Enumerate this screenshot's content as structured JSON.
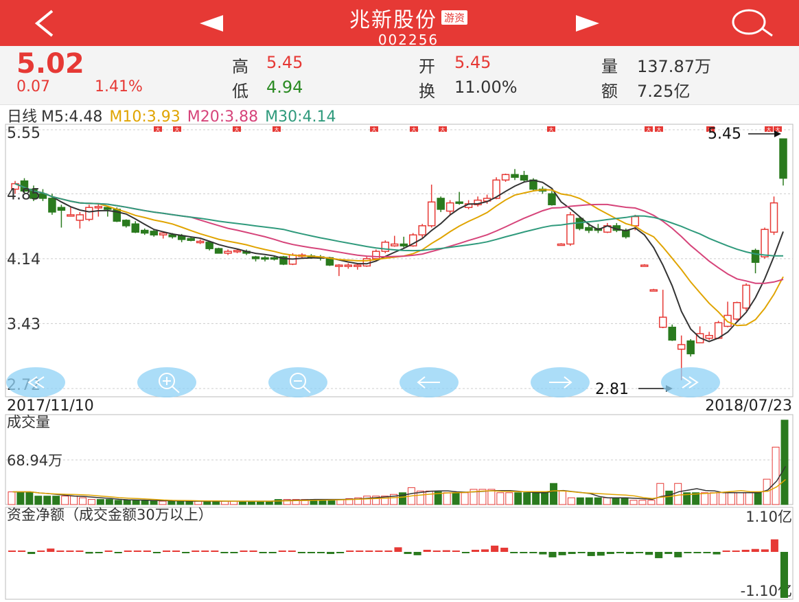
{
  "header": {
    "stock_name": "兆新股份",
    "tag": "游资",
    "stock_code": "002256",
    "back_icon": "back-icon",
    "prev_icon": "prev-stock-icon",
    "next_icon": "next-stock-icon",
    "search_icon": "search-icon"
  },
  "quote": {
    "price": "5.02",
    "change": "0.07",
    "change_pct": "1.41%",
    "high_label": "高",
    "high": "5.45",
    "low_label": "低",
    "low": "4.94",
    "open_label": "开",
    "open": "5.45",
    "turnover_label": "换",
    "turnover": "11.00%",
    "volume_label": "量",
    "volume": "137.87万",
    "amount_label": "额",
    "amount": "7.25亿"
  },
  "ma": {
    "period": "日线",
    "m5": "M5:4.48",
    "m10": "M10:3.93",
    "m20": "M20:3.88",
    "m30": "M30:4.14"
  },
  "colors": {
    "red": "#e63935",
    "green": "#2a7a1e",
    "m5": "#333333",
    "m10": "#e0a400",
    "m20": "#d6447a",
    "m30": "#2f9a7c"
  },
  "toolbar": [
    "rewind-icon",
    "zoom-in-icon",
    "zoom-out-icon",
    "left-arrow-icon",
    "right-arrow-icon",
    "fast-forward-icon"
  ],
  "chart_data": [
    {
      "type": "candlestick",
      "title": "日线",
      "y_ticks": [
        "5.55",
        "4.85",
        "4.14",
        "3.43",
        "2.72"
      ],
      "ylim": [
        2.72,
        5.55
      ],
      "x_start": "2017/11/10",
      "x_end": "2018/07/23",
      "max_annotation": "5.45",
      "min_annotation": "2.81",
      "marker_label": "大",
      "candles": [
        {
          "o": 4.9,
          "c": 4.96,
          "h": 4.99,
          "l": 4.85
        },
        {
          "o": 4.99,
          "c": 4.88,
          "h": 5.02,
          "l": 4.86
        },
        {
          "o": 4.9,
          "c": 4.8,
          "h": 4.94,
          "l": 4.77
        },
        {
          "o": 4.85,
          "c": 4.8,
          "h": 4.9,
          "l": 4.77
        },
        {
          "o": 4.8,
          "c": 4.65,
          "h": 4.85,
          "l": 4.62
        },
        {
          "o": 4.7,
          "c": 4.67,
          "h": 4.73,
          "l": 4.48
        },
        {
          "o": 4.62,
          "c": 4.62,
          "h": 4.7,
          "l": 4.6
        },
        {
          "o": 4.56,
          "c": 4.62,
          "h": 4.65,
          "l": 4.47
        },
        {
          "o": 4.57,
          "c": 4.7,
          "h": 4.73,
          "l": 4.55
        },
        {
          "o": 4.7,
          "c": 4.71,
          "h": 4.74,
          "l": 4.6
        },
        {
          "o": 4.7,
          "c": 4.68,
          "h": 4.72,
          "l": 4.6
        },
        {
          "o": 4.68,
          "c": 4.55,
          "h": 4.7,
          "l": 4.54
        },
        {
          "o": 4.56,
          "c": 4.5,
          "h": 4.57,
          "l": 4.48
        },
        {
          "o": 4.52,
          "c": 4.43,
          "h": 4.55,
          "l": 4.42
        },
        {
          "o": 4.45,
          "c": 4.42,
          "h": 4.47,
          "l": 4.4
        },
        {
          "o": 4.44,
          "c": 4.4,
          "h": 4.46,
          "l": 4.38
        },
        {
          "o": 4.4,
          "c": 4.42,
          "h": 4.44,
          "l": 4.36
        },
        {
          "o": 4.4,
          "c": 4.38,
          "h": 4.42,
          "l": 4.36
        },
        {
          "o": 4.39,
          "c": 4.35,
          "h": 4.41,
          "l": 4.32
        },
        {
          "o": 4.36,
          "c": 4.34,
          "h": 4.38,
          "l": 4.33
        },
        {
          "o": 4.33,
          "c": 4.33,
          "h": 4.35,
          "l": 4.3
        },
        {
          "o": 4.32,
          "c": 4.25,
          "h": 4.33,
          "l": 4.23
        },
        {
          "o": 4.25,
          "c": 4.2,
          "h": 4.26,
          "l": 4.2
        },
        {
          "o": 4.2,
          "c": 4.22,
          "h": 4.24,
          "l": 4.18
        },
        {
          "o": 4.22,
          "c": 4.23,
          "h": 4.25,
          "l": 4.2
        },
        {
          "o": 4.22,
          "c": 4.2,
          "h": 4.24,
          "l": 4.18
        },
        {
          "o": 4.16,
          "c": 4.14,
          "h": 4.17,
          "l": 4.11
        },
        {
          "o": 4.15,
          "c": 4.14,
          "h": 4.17,
          "l": 4.11
        },
        {
          "o": 4.15,
          "c": 4.14,
          "h": 4.17,
          "l": 4.12
        },
        {
          "o": 4.16,
          "c": 4.08,
          "h": 4.17,
          "l": 4.07
        },
        {
          "o": 4.08,
          "c": 4.18,
          "h": 4.2,
          "l": 4.07
        },
        {
          "o": 4.17,
          "c": 4.18,
          "h": 4.2,
          "l": 4.14
        },
        {
          "o": 4.17,
          "c": 4.16,
          "h": 4.19,
          "l": 4.14
        },
        {
          "o": 4.16,
          "c": 4.15,
          "h": 4.18,
          "l": 4.12
        },
        {
          "o": 4.15,
          "c": 4.07,
          "h": 4.16,
          "l": 4.06
        },
        {
          "o": 4.07,
          "c": 4.07,
          "h": 4.08,
          "l": 3.95
        },
        {
          "o": 4.07,
          "c": 4.07,
          "h": 4.09,
          "l": 4.03
        },
        {
          "o": 4.06,
          "c": 4.07,
          "h": 4.08,
          "l": 4.02
        },
        {
          "o": 4.06,
          "c": 4.14,
          "h": 4.16,
          "l": 4.05
        },
        {
          "o": 4.14,
          "c": 4.22,
          "h": 4.24,
          "l": 4.12
        },
        {
          "o": 4.22,
          "c": 4.32,
          "h": 4.34,
          "l": 4.2
        },
        {
          "o": 4.28,
          "c": 4.3,
          "h": 4.39,
          "l": 4.27
        },
        {
          "o": 4.3,
          "c": 4.28,
          "h": 4.38,
          "l": 4.26
        },
        {
          "o": 4.28,
          "c": 4.4,
          "h": 4.42,
          "l": 4.27
        },
        {
          "o": 4.4,
          "c": 4.5,
          "h": 4.52,
          "l": 4.37
        },
        {
          "o": 4.5,
          "c": 4.76,
          "h": 4.95,
          "l": 4.48
        },
        {
          "o": 4.8,
          "c": 4.68,
          "h": 4.82,
          "l": 4.65
        },
        {
          "o": 4.66,
          "c": 4.75,
          "h": 4.78,
          "l": 4.62
        },
        {
          "o": 4.76,
          "c": 4.75,
          "h": 4.87,
          "l": 4.73
        },
        {
          "o": 4.7,
          "c": 4.74,
          "h": 4.78,
          "l": 4.68
        },
        {
          "o": 4.73,
          "c": 4.78,
          "h": 4.82,
          "l": 4.71
        },
        {
          "o": 4.77,
          "c": 4.8,
          "h": 4.84,
          "l": 4.74
        },
        {
          "o": 4.8,
          "c": 5.0,
          "h": 5.03,
          "l": 4.79
        },
        {
          "o": 5.0,
          "c": 5.06,
          "h": 5.07,
          "l": 4.98
        },
        {
          "o": 5.06,
          "c": 5.03,
          "h": 5.12,
          "l": 5.0
        },
        {
          "o": 5.05,
          "c": 5.0,
          "h": 5.1,
          "l": 4.98
        },
        {
          "o": 5.0,
          "c": 4.9,
          "h": 5.02,
          "l": 4.88
        },
        {
          "o": 4.9,
          "c": 4.88,
          "h": 4.93,
          "l": 4.85
        },
        {
          "o": 4.85,
          "c": 4.73,
          "h": 4.88,
          "l": 4.72
        },
        {
          "o": 4.3,
          "c": 4.3,
          "h": 4.31,
          "l": 4.3
        },
        {
          "o": 4.3,
          "c": 4.62,
          "h": 4.65,
          "l": 4.28
        },
        {
          "o": 4.58,
          "c": 4.47,
          "h": 4.6,
          "l": 4.45
        },
        {
          "o": 4.48,
          "c": 4.45,
          "h": 4.53,
          "l": 4.42
        },
        {
          "o": 4.47,
          "c": 4.45,
          "h": 4.52,
          "l": 4.42
        },
        {
          "o": 4.43,
          "c": 4.5,
          "h": 4.53,
          "l": 4.42
        },
        {
          "o": 4.5,
          "c": 4.45,
          "h": 4.53,
          "l": 4.43
        },
        {
          "o": 4.45,
          "c": 4.38,
          "h": 4.47,
          "l": 4.36
        },
        {
          "o": 4.5,
          "c": 4.6,
          "h": 4.62,
          "l": 4.45
        },
        {
          "o": 4.07,
          "c": 4.07,
          "h": 4.08,
          "l": 4.06
        },
        {
          "o": 3.8,
          "c": 3.8,
          "h": 3.81,
          "l": 3.79
        },
        {
          "o": 3.39,
          "c": 3.5,
          "h": 3.8,
          "l": 3.38
        },
        {
          "o": 3.39,
          "c": 3.25,
          "h": 3.42,
          "l": 3.24
        },
        {
          "o": 3.15,
          "c": 3.2,
          "h": 3.3,
          "l": 2.81
        },
        {
          "o": 3.24,
          "c": 3.1,
          "h": 3.26,
          "l": 3.07
        },
        {
          "o": 3.22,
          "c": 3.32,
          "h": 3.4,
          "l": 3.22
        },
        {
          "o": 3.27,
          "c": 3.3,
          "h": 3.34,
          "l": 3.25
        },
        {
          "o": 3.27,
          "c": 3.44,
          "h": 3.46,
          "l": 3.26
        },
        {
          "o": 3.4,
          "c": 3.52,
          "h": 3.67,
          "l": 3.39
        },
        {
          "o": 3.48,
          "c": 3.66,
          "h": 3.67,
          "l": 3.46
        },
        {
          "o": 3.6,
          "c": 3.85,
          "h": 3.87,
          "l": 3.57
        },
        {
          "o": 4.23,
          "c": 4.1,
          "h": 4.25,
          "l": 3.98
        },
        {
          "o": 4.16,
          "c": 4.46,
          "h": 4.48,
          "l": 4.14
        },
        {
          "o": 4.43,
          "c": 4.75,
          "h": 4.82,
          "l": 4.4
        },
        {
          "o": 5.45,
          "c": 5.02,
          "h": 5.45,
          "l": 4.94
        }
      ]
    },
    {
      "type": "bar",
      "title": "成交量",
      "y_tick": "68.94万",
      "ymax": 100,
      "values": [
        15,
        15,
        15,
        10,
        10,
        10,
        10,
        10,
        8,
        6,
        6,
        6,
        5,
        5,
        5,
        5,
        4,
        4,
        4,
        4,
        4,
        4,
        4,
        4,
        4,
        4,
        4,
        4,
        4,
        4,
        6,
        6,
        6,
        6,
        6,
        6,
        6,
        6,
        7,
        8,
        10,
        10,
        10,
        12,
        14,
        20,
        16,
        16,
        15,
        14,
        14,
        14,
        18,
        18,
        18,
        14,
        14,
        14,
        14,
        14,
        14,
        25,
        16,
        8,
        8,
        8,
        8,
        8,
        8,
        8,
        5,
        5,
        5,
        25,
        16,
        25,
        14,
        14,
        14,
        14,
        14,
        14,
        14,
        14,
        14,
        30,
        68,
        100
      ]
    },
    {
      "type": "bar",
      "title": "资金净额（成交金额30万以上）",
      "y_ticks": [
        "1.10亿",
        "-1.10亿"
      ],
      "ylim": [
        -1.1,
        1.1
      ],
      "values": [
        0.02,
        0.03,
        -0.05,
        0.03,
        0.08,
        0.02,
        0.03,
        0.01,
        -0.04,
        -0.02,
        0.01,
        -0.01,
        0.01,
        0.02,
        0.01,
        -0.02,
        0.01,
        0.01,
        -0.01,
        0.01,
        0.02,
        0.01,
        -0.02,
        -0.01,
        0.02,
        0.01,
        -0.03,
        -0.01,
        0.01,
        0.01,
        -0.02,
        -0.01,
        -0.03,
        -0.05,
        -0.03,
        0.02,
        0.03,
        0.01,
        0.02,
        0.03,
        0.11,
        -0.05,
        -0.08,
        0.05,
        0.03,
        0.04,
        0.01,
        -0.03,
        0.05,
        0.06,
        0.15,
        0.1,
        -0.02,
        -0.02,
        -0.03,
        -0.06,
        -0.13,
        -0.08,
        -0.05,
        -0.03,
        -0.1,
        -0.09,
        -0.05,
        -0.03,
        -0.05,
        -0.03,
        -0.07,
        -0.15,
        -0.05,
        -0.13,
        -0.03,
        -0.03,
        -0.03,
        -0.06,
        0.02,
        0.02,
        0.05,
        0.07,
        0.06,
        0.3,
        -1.1
      ]
    }
  ]
}
